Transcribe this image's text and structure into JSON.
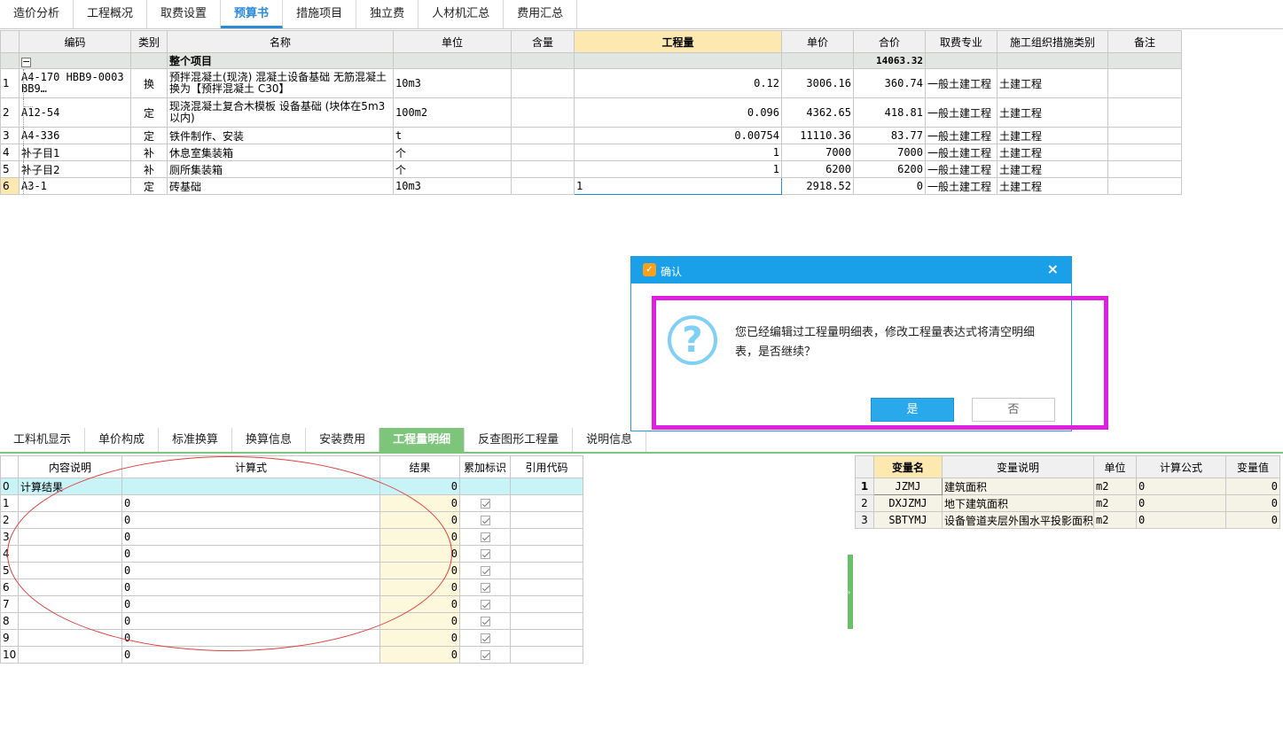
{
  "top_tabs": [
    "造价分析",
    "工程概况",
    "取费设置",
    "预算书",
    "措施项目",
    "独立费",
    "人材机汇总",
    "费用汇总"
  ],
  "main_table": {
    "headers": [
      "编码",
      "类别",
      "名称",
      "单位",
      "含量",
      "工程量",
      "单价",
      "合价",
      "取费专业",
      "施工组织措施类别",
      "备注"
    ],
    "summary": {
      "name": "整个项目",
      "total": "14063.32"
    },
    "rows": [
      {
        "num": "1",
        "code": "A4-170 HBB9-0003 BB9…",
        "type": "换",
        "name": "预拌混凝土(现浇) 混凝土设备基础 无筋混凝土  换为【预拌混凝土 C30】",
        "unit": "10m3",
        "qty": "0.12",
        "price": "3006.16",
        "total": "360.74",
        "fee": "一般土建工程",
        "cat": "土建工程"
      },
      {
        "num": "2",
        "code": "A12-54",
        "type": "定",
        "name": "现浇混凝土复合木模板 设备基础 (块体在5m3以内)",
        "unit": "100m2",
        "qty": "0.096",
        "price": "4362.65",
        "total": "418.81",
        "fee": "一般土建工程",
        "cat": "土建工程"
      },
      {
        "num": "3",
        "code": "A4-336",
        "type": "定",
        "name": "铁件制作、安装",
        "unit": "t",
        "qty": "0.00754",
        "price": "11110.36",
        "total": "83.77",
        "fee": "一般土建工程",
        "cat": "土建工程"
      },
      {
        "num": "4",
        "code": "补子目1",
        "type": "补",
        "name": "休息室集装箱",
        "unit": "个",
        "qty": "1",
        "price": "7000",
        "total": "7000",
        "fee": "一般土建工程",
        "cat": "土建工程"
      },
      {
        "num": "5",
        "code": "补子目2",
        "type": "补",
        "name": "厕所集装箱",
        "unit": "个",
        "qty": "1",
        "price": "6200",
        "total": "6200",
        "fee": "一般土建工程",
        "cat": "土建工程"
      },
      {
        "num": "6",
        "code": "A3-1",
        "type": "定",
        "name": "砖基础",
        "unit": "10m3",
        "qty": "1",
        "price": "2918.52",
        "total": "0",
        "fee": "一般土建工程",
        "cat": "土建工程"
      }
    ]
  },
  "bottom_tabs": [
    "工料机显示",
    "单价构成",
    "标准换算",
    "换算信息",
    "安装费用",
    "工程量明细",
    "反查图形工程量",
    "说明信息"
  ],
  "calc_table": {
    "headers": [
      "内容说明",
      "计算式",
      "结果",
      "累加标识",
      "引用代码"
    ],
    "result_row": {
      "num": "0",
      "desc": "计算结果",
      "result": "0"
    },
    "rows": [
      {
        "num": "1",
        "formula": "0",
        "result": "0"
      },
      {
        "num": "2",
        "formula": "0",
        "result": "0"
      },
      {
        "num": "3",
        "formula": "0",
        "result": "0"
      },
      {
        "num": "4",
        "formula": "0",
        "result": "0"
      },
      {
        "num": "5",
        "formula": "0",
        "result": "0"
      },
      {
        "num": "6",
        "formula": "0",
        "result": "0"
      },
      {
        "num": "7",
        "formula": "0",
        "result": "0"
      },
      {
        "num": "8",
        "formula": "0",
        "result": "0"
      },
      {
        "num": "9",
        "formula": "0",
        "result": "0"
      },
      {
        "num": "10",
        "formula": "0",
        "result": "0"
      }
    ]
  },
  "var_table": {
    "headers": [
      "变量名",
      "变量说明",
      "单位",
      "计算公式",
      "变量值"
    ],
    "rows": [
      {
        "num": "1",
        "name": "JZMJ",
        "desc": "建筑面积",
        "unit": "m2",
        "formula": "0",
        "value": "0"
      },
      {
        "num": "2",
        "name": "DXJZMJ",
        "desc": "地下建筑面积",
        "unit": "m2",
        "formula": "0",
        "value": "0"
      },
      {
        "num": "3",
        "name": "SBTYMJ",
        "desc": "设备管道夹层外围水平投影面积",
        "unit": "m2",
        "formula": "0",
        "value": "0"
      }
    ]
  },
  "dialog": {
    "title": "确认",
    "close": "×",
    "message": "您已经编辑过工程量明细表，修改工程量表达式将清空明细表，是否继续？",
    "yes": "是",
    "no": "否"
  },
  "colors": {
    "accent": "#2a8ad8",
    "tab_green": "#7dc57a",
    "dialog_blue": "#1aa0e8",
    "annotation_magenta": "#e020e0",
    "annotation_red": "#e04040"
  }
}
